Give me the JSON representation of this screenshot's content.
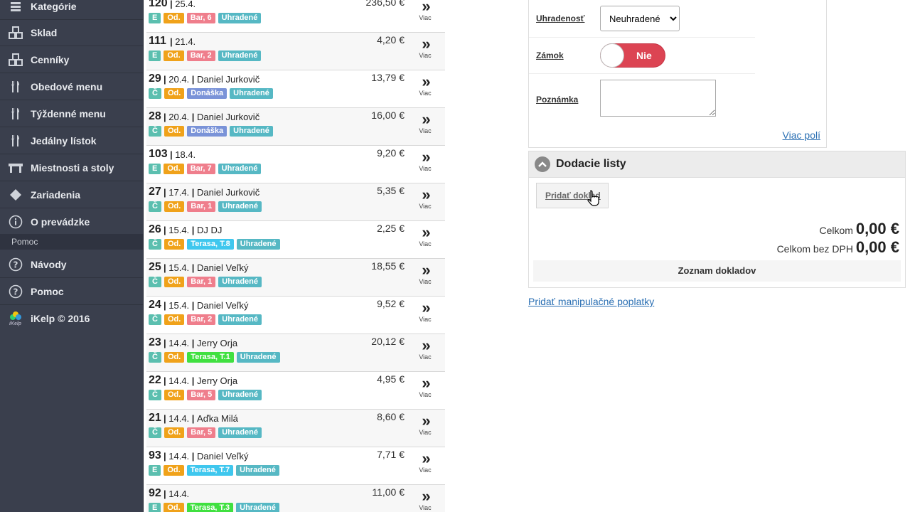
{
  "sidebar": {
    "items": [
      {
        "label": "Kategórie",
        "icon": "categories-icon"
      },
      {
        "label": "Sklad",
        "icon": "warehouse-icon"
      },
      {
        "label": "Cenníky",
        "icon": "pricelist-icon"
      },
      {
        "label": "Obedové menu",
        "icon": "fork-knife-icon"
      },
      {
        "label": "Týždenné menu",
        "icon": "fork-knife-icon"
      },
      {
        "label": "Jedálny lístok",
        "icon": "fork-knife-icon"
      },
      {
        "label": "Miestnosti a stoly",
        "icon": "table-icon"
      },
      {
        "label": "Zariadenia",
        "icon": "diamond-icon"
      },
      {
        "label": "O prevádzke",
        "icon": "info-icon"
      }
    ],
    "section_label": "Pomoc",
    "help_items": [
      {
        "label": "Návody",
        "icon": "question-icon"
      },
      {
        "label": "Pomoc",
        "icon": "question-icon"
      }
    ],
    "brand": {
      "label": "iKelp © 2016",
      "logo_text": "iKelp"
    }
  },
  "orders": [
    {
      "num": "120",
      "date": "25.4.",
      "name": "",
      "price": "236,50 €",
      "badges": [
        {
          "t": "E",
          "c": "teal"
        },
        {
          "t": "Od.",
          "c": "orange"
        },
        {
          "t": "Bar, 6",
          "c": "pink"
        },
        {
          "t": "Uhradené",
          "c": "paid"
        }
      ]
    },
    {
      "num": "111",
      "date": "21.4.",
      "name": "",
      "price": "4,20 €",
      "badges": [
        {
          "t": "E",
          "c": "teal"
        },
        {
          "t": "Od.",
          "c": "orange"
        },
        {
          "t": "Bar, 2",
          "c": "pink"
        },
        {
          "t": "Uhradené",
          "c": "paid"
        }
      ]
    },
    {
      "num": "29",
      "date": "20.4.",
      "name": "Daniel Jurkovič",
      "price": "13,79 €",
      "badges": [
        {
          "t": "Č",
          "c": "teal"
        },
        {
          "t": "Od.",
          "c": "orange"
        },
        {
          "t": "Donáška",
          "c": "blue"
        },
        {
          "t": "Uhradené",
          "c": "paid"
        }
      ]
    },
    {
      "num": "28",
      "date": "20.4.",
      "name": "Daniel Jurkovič",
      "price": "16,00 €",
      "badges": [
        {
          "t": "Č",
          "c": "teal"
        },
        {
          "t": "Od.",
          "c": "orange"
        },
        {
          "t": "Donáška",
          "c": "blue"
        },
        {
          "t": "Uhradené",
          "c": "paid"
        }
      ]
    },
    {
      "num": "103",
      "date": "18.4.",
      "name": "",
      "price": "9,20 €",
      "badges": [
        {
          "t": "E",
          "c": "teal"
        },
        {
          "t": "Od.",
          "c": "orange"
        },
        {
          "t": "Bar, 7",
          "c": "pink"
        },
        {
          "t": "Uhradené",
          "c": "paid"
        }
      ]
    },
    {
      "num": "27",
      "date": "17.4.",
      "name": "Daniel Jurkovič",
      "price": "5,35 €",
      "badges": [
        {
          "t": "Č",
          "c": "teal"
        },
        {
          "t": "Od.",
          "c": "orange"
        },
        {
          "t": "Bar, 1",
          "c": "pink"
        },
        {
          "t": "Uhradené",
          "c": "paid"
        }
      ]
    },
    {
      "num": "26",
      "date": "15.4.",
      "name": "DJ DJ",
      "price": "2,25 €",
      "badges": [
        {
          "t": "Č",
          "c": "teal"
        },
        {
          "t": "Od.",
          "c": "orange"
        },
        {
          "t": "Terasa, T.8",
          "c": "cyan"
        },
        {
          "t": "Uhradené",
          "c": "paid"
        }
      ]
    },
    {
      "num": "25",
      "date": "15.4.",
      "name": "Daniel Veľký",
      "price": "18,55 €",
      "badges": [
        {
          "t": "Č",
          "c": "teal"
        },
        {
          "t": "Od.",
          "c": "orange"
        },
        {
          "t": "Bar, 1",
          "c": "pink"
        },
        {
          "t": "Uhradené",
          "c": "paid"
        }
      ]
    },
    {
      "num": "24",
      "date": "15.4.",
      "name": "Daniel Veľký",
      "price": "9,52 €",
      "badges": [
        {
          "t": "Č",
          "c": "teal"
        },
        {
          "t": "Od.",
          "c": "orange"
        },
        {
          "t": "Bar, 2",
          "c": "pink"
        },
        {
          "t": "Uhradené",
          "c": "paid"
        }
      ]
    },
    {
      "num": "23",
      "date": "14.4.",
      "name": "Jerry Orja",
      "price": "20,12 €",
      "badges": [
        {
          "t": "Č",
          "c": "teal"
        },
        {
          "t": "Od.",
          "c": "orange"
        },
        {
          "t": "Terasa, T.1",
          "c": "green"
        },
        {
          "t": "Uhradené",
          "c": "paid"
        }
      ]
    },
    {
      "num": "22",
      "date": "14.4.",
      "name": "Jerry Orja",
      "price": "4,95 €",
      "badges": [
        {
          "t": "Č",
          "c": "teal"
        },
        {
          "t": "Od.",
          "c": "orange"
        },
        {
          "t": "Bar, 5",
          "c": "pink"
        },
        {
          "t": "Uhradené",
          "c": "paid"
        }
      ]
    },
    {
      "num": "21",
      "date": "14.4.",
      "name": "Aďka Milá",
      "price": "8,60 €",
      "badges": [
        {
          "t": "Č",
          "c": "teal"
        },
        {
          "t": "Od.",
          "c": "orange"
        },
        {
          "t": "Bar, 5",
          "c": "pink"
        },
        {
          "t": "Uhradené",
          "c": "paid"
        }
      ]
    },
    {
      "num": "93",
      "date": "14.4.",
      "name": "Daniel Veľký",
      "price": "7,71 €",
      "badges": [
        {
          "t": "E",
          "c": "teal"
        },
        {
          "t": "Od.",
          "c": "orange"
        },
        {
          "t": "Terasa, T.7",
          "c": "cyan"
        },
        {
          "t": "Uhradené",
          "c": "paid"
        }
      ]
    },
    {
      "num": "92",
      "date": "14.4.",
      "name": "",
      "price": "11,00 €",
      "badges": [
        {
          "t": "E",
          "c": "teal"
        },
        {
          "t": "Od.",
          "c": "orange"
        },
        {
          "t": "Terasa, T.3",
          "c": "green"
        },
        {
          "t": "Uhradené",
          "c": "paid"
        }
      ]
    }
  ],
  "more_label": "Viac",
  "form": {
    "paid_label": "Uhradenosť",
    "paid_value": "Neuhradené",
    "lock_label": "Zámok",
    "lock_value": "Nie",
    "note_label": "Poznámka",
    "more_fields": "Viac polí"
  },
  "delivery": {
    "title": "Dodacie listy",
    "add_button": "Pridať doklad",
    "total_label": "Celkom",
    "total_value": "0,00 €",
    "total_novat_label": "Celkom bez DPH",
    "total_novat_value": "0,00 €",
    "list_label": "Zoznam dokladov"
  },
  "fees_link": "Pridať manipulačné poplatky",
  "colors": {
    "sidebar": "#3a3f4d",
    "toggle_off": "#dc4453",
    "link": "#2a6fb3"
  }
}
